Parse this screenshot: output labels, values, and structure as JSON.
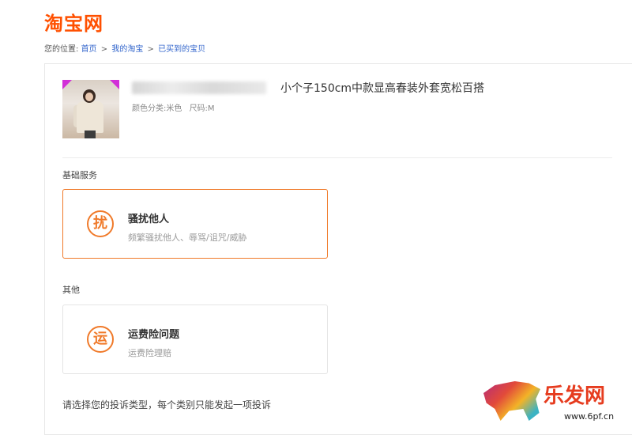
{
  "header": {
    "logo": "淘宝网"
  },
  "breadcrumb": {
    "prefix": "您的位置:",
    "items": [
      "首页",
      "我的淘宝",
      "已买到的宝贝"
    ],
    "separator": ">"
  },
  "product": {
    "title": "小个子150cm中款显高春装外套宽松百搭",
    "spec_color": "颜色分类:米色",
    "spec_size": "尺码:M"
  },
  "sections": [
    {
      "label": "基础服务",
      "option": {
        "icon_char": "扰",
        "name": "骚扰他人",
        "desc": "频繁骚扰他人、辱骂/诅咒/威胁",
        "selected": true
      }
    },
    {
      "label": "其他",
      "option": {
        "icon_char": "运",
        "name": "运费险问题",
        "desc": "运费险理赔",
        "selected": false
      }
    }
  ],
  "note": "请选择您的投诉类型，每个类别只能发起一项投诉",
  "watermark": {
    "brand": "乐发网",
    "site": "www.6pf.cn"
  },
  "colors": {
    "brand": "#ff5000",
    "accent": "#f07a2a",
    "link": "#3366cc"
  }
}
